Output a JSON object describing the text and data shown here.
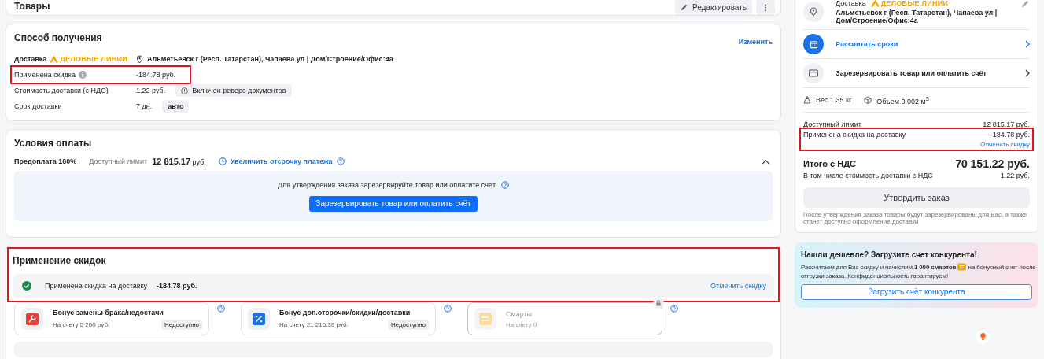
{
  "goods": {
    "title": "Товары",
    "buttons": [
      {
        "kind": "edit",
        "label": "Редактировать"
      },
      {
        "kind": "more",
        "label": "⋮"
      }
    ]
  },
  "delivery": {
    "title": "Способ получения",
    "change_link": "Изменить",
    "method_label": "Доставка",
    "carrier_logo": "ДЕЛОВЫЕ ЛИНИИ",
    "address": "Альметьевск г (Респ. Татарстан), Чапаева ул | Дом/Строение/Офис:4а",
    "rows": [
      {
        "kind": "info",
        "label": "Применена скидка",
        "value": "-184.78 руб.",
        "highlighted": true
      },
      {
        "kind": "tag_info",
        "label": "Стоимость доставки (с НДС)",
        "value": "1.22 руб.",
        "tag": "Включен реверс документов",
        "highlighted": false
      },
      {
        "kind": "tag",
        "label": "Срок доставки",
        "value": "7 дн.",
        "tag": "авто",
        "highlighted": false
      }
    ]
  },
  "payment": {
    "title": "Условия оплаты",
    "prepay": "Предоплата 100%",
    "limit_label": "Доступный лимит",
    "limit_value": "12 815.17",
    "limit_unit": "руб.",
    "extend_link": "Увеличить отсрочку платежа",
    "expanded": true,
    "notice": "Для утверждения заказа зарезервируйте товар или оплатите счёт",
    "button": "Зарезервировать товар или оплатить счёт"
  },
  "discounts": {
    "title": "Применение скидок",
    "highlighted": true,
    "applied_label": "Применена скидка на доставку",
    "applied_value": "-184.78 руб.",
    "cancel_link": "Отменить скидку",
    "bonuses": [
      {
        "kind": "repair",
        "title": "Бонус замены брака/недостачи",
        "balance": "На счету 5 200 руб.",
        "badge": "Недоступно",
        "disabled": false
      },
      {
        "kind": "percent",
        "title": "Бонус доп.отсрочки/скидки/доставки",
        "balance": "На счету 21 216.39 руб.",
        "badge": "Недоступно",
        "disabled": false
      },
      {
        "kind": "smarts",
        "title": "Смарты",
        "balance": "На счету 0",
        "disabled": true
      }
    ]
  },
  "summary": {
    "delivery_label": "Доставка",
    "carrier_logo": "ДЕЛОВЫЕ ЛИНИИ",
    "address": "Альметьевск г (Респ. Татарстан), Чапаева ул | Дом/Строение/Офис:4а",
    "actions": [
      {
        "kind": "calendar",
        "label": "Рассчитать сроки"
      },
      {
        "kind": "card",
        "label": "Зарезервировать товар или оплатить счёт"
      }
    ],
    "weight": "Вес 1.35 кг",
    "volume": "Объем 0.002 м$^{3}$",
    "lines": [
      {
        "label": "Доступный лимит",
        "value": "12 815.17 руб.",
        "highlighted": false
      },
      {
        "label": "Применена скидка на доставку",
        "value": "-184.78 руб.",
        "link": "Отменить скидку",
        "highlighted": true
      }
    ],
    "total_label": "Итого с НДС",
    "total_value": "70 151.22 руб.",
    "delivery_cost_label": "В том числе стоимость доставки с НДС",
    "delivery_cost_value": "1.22 руб.",
    "confirm_button": "Утвердить заказ",
    "confirm_note": "После утверждения заказа товары будут зарезервированы для Вас, а также станет доступно оформление доставки"
  },
  "promo": {
    "title": "Нашли дешевле? Загрузите счет конкурента!",
    "text_before": "Рассчитаем для Вас скидку и начислим **1 000 смартов**",
    "text_after": "на бонусный счет после",
    "text_line2": "отгрузки заказа. Конфиденциальность гарантируем!",
    "button": "Загрузить счёт конкурента"
  }
}
